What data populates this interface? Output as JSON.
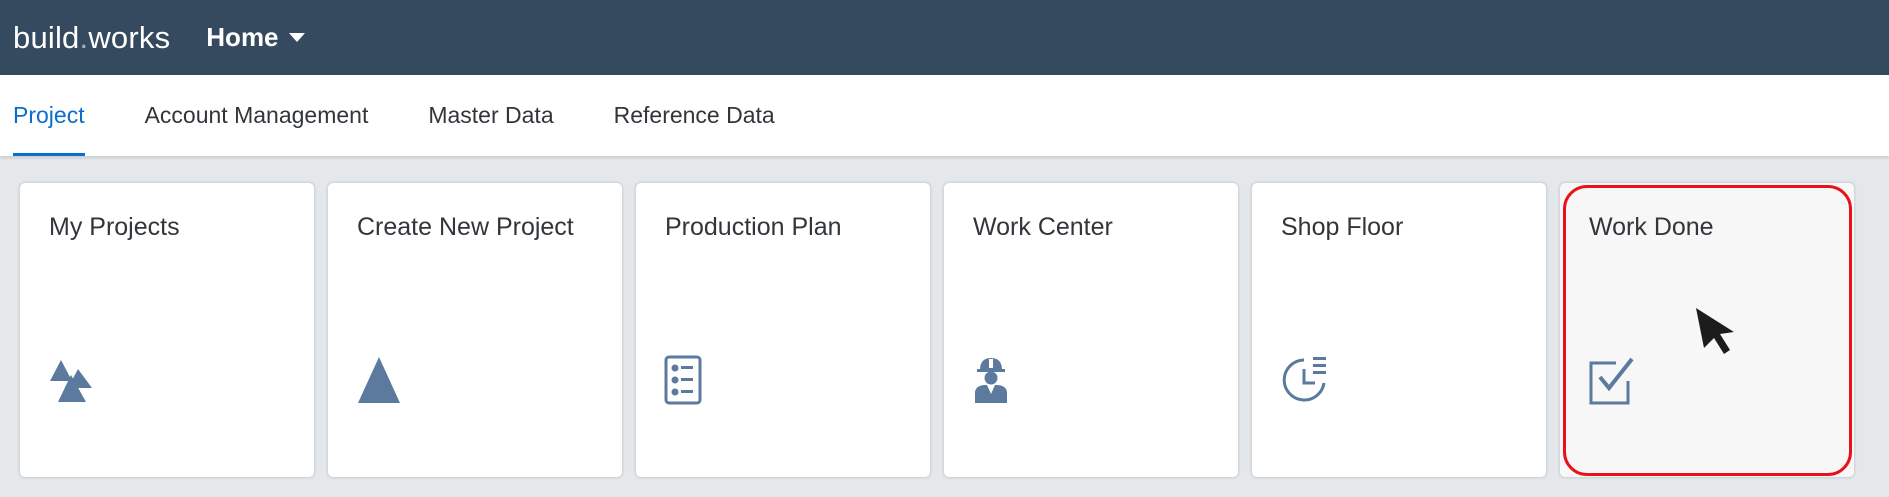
{
  "shell": {
    "brand_part1": "build",
    "brand_dot": ".",
    "brand_part2": "works",
    "menu_label": "Home"
  },
  "tabs": [
    {
      "label": "Project",
      "active": true
    },
    {
      "label": "Account Management",
      "active": false
    },
    {
      "label": "Master Data",
      "active": false
    },
    {
      "label": "Reference Data",
      "active": false
    }
  ],
  "tiles": [
    {
      "title": "My Projects",
      "icon": "mountains-icon"
    },
    {
      "title": "Create New Project",
      "icon": "triangle-icon"
    },
    {
      "title": "Production Plan",
      "icon": "checklist-icon"
    },
    {
      "title": "Work Center",
      "icon": "worker-icon"
    },
    {
      "title": "Shop Floor",
      "icon": "clock-list-icon"
    },
    {
      "title": "Work Done",
      "icon": "checkbox-icon"
    }
  ],
  "colors": {
    "shell_bg": "#354a5f",
    "accent": "#0a6ed1",
    "icon": "#5b7a9d",
    "highlight": "#e8131a"
  }
}
